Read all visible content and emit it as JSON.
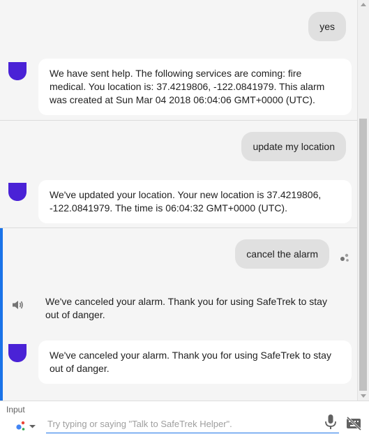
{
  "conversation": [
    {
      "user": "yes",
      "bot_card": "We have sent help. The following services are coming: fire medical. You location is: 37.4219806, -122.0841979. This alarm was created at Sun Mar 04 2018 06:04:06 GMT+0000 (UTC)."
    },
    {
      "user": "update my location",
      "bot_card": "We've updated your location. Your new location is 37.4219806, -122.0841979. The time is 06:04:32 GMT+0000 (UTC)."
    },
    {
      "user": "cancel the alarm",
      "bot_speech": "We've canceled your alarm. Thank you for using SafeTrek to stay out of danger.",
      "bot_card": "We've canceled your alarm. Thank you for using SafeTrek to stay out of danger."
    }
  ],
  "input": {
    "label": "Input",
    "placeholder": "Try typing or saying \"Talk to SafeTrek Helper\"."
  },
  "icons": {
    "bot_avatar": "shield-avatar-icon",
    "speaker": "speaker-icon",
    "debug": "debug-dots-icon",
    "mode": "assistant-dots-icon",
    "mic": "mic-icon",
    "keyboard_off": "keyboard-off-icon"
  },
  "colors": {
    "accent": "#1a73e8",
    "avatar": "#4a22d6",
    "user_bubble": "#e0e0e0",
    "card": "#ffffff",
    "background": "#f5f5f5"
  }
}
